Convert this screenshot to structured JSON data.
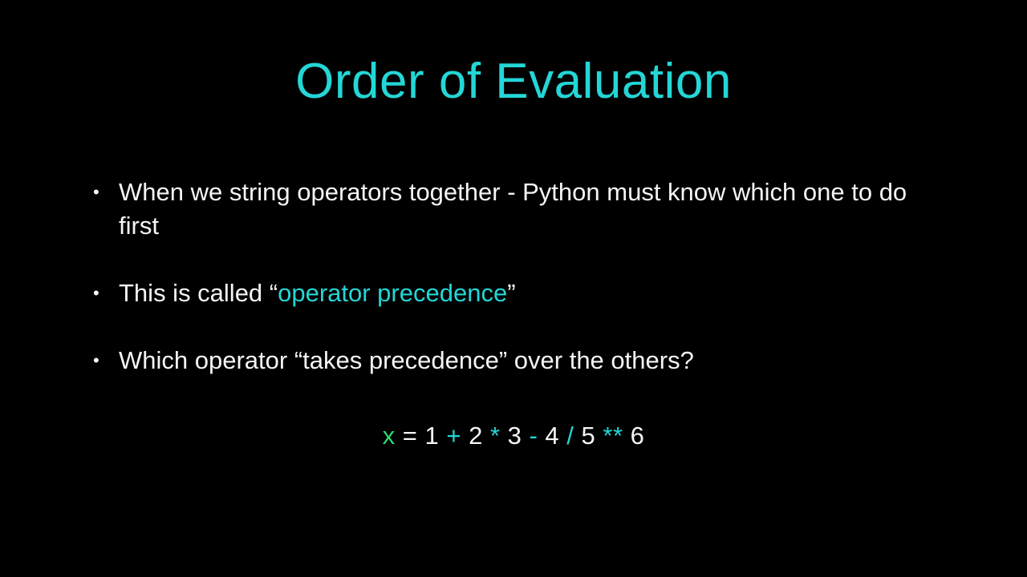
{
  "title": "Order of Evaluation",
  "bullets": {
    "b1": "When we string operators together - Python must know which one to do first",
    "b2_pre": "This is called “",
    "b2_term": "operator precedence",
    "b2_post": "”",
    "b3": "Which operator “takes precedence” over the others?"
  },
  "code": {
    "var": "x",
    "eq": " = ",
    "n1": "1",
    "op1": " + ",
    "n2": "2",
    "op2": " * ",
    "n3": "3",
    "op3": " - ",
    "n4": "4",
    "op4": " / ",
    "n5": "5",
    "op5": " ** ",
    "n6": "6"
  }
}
